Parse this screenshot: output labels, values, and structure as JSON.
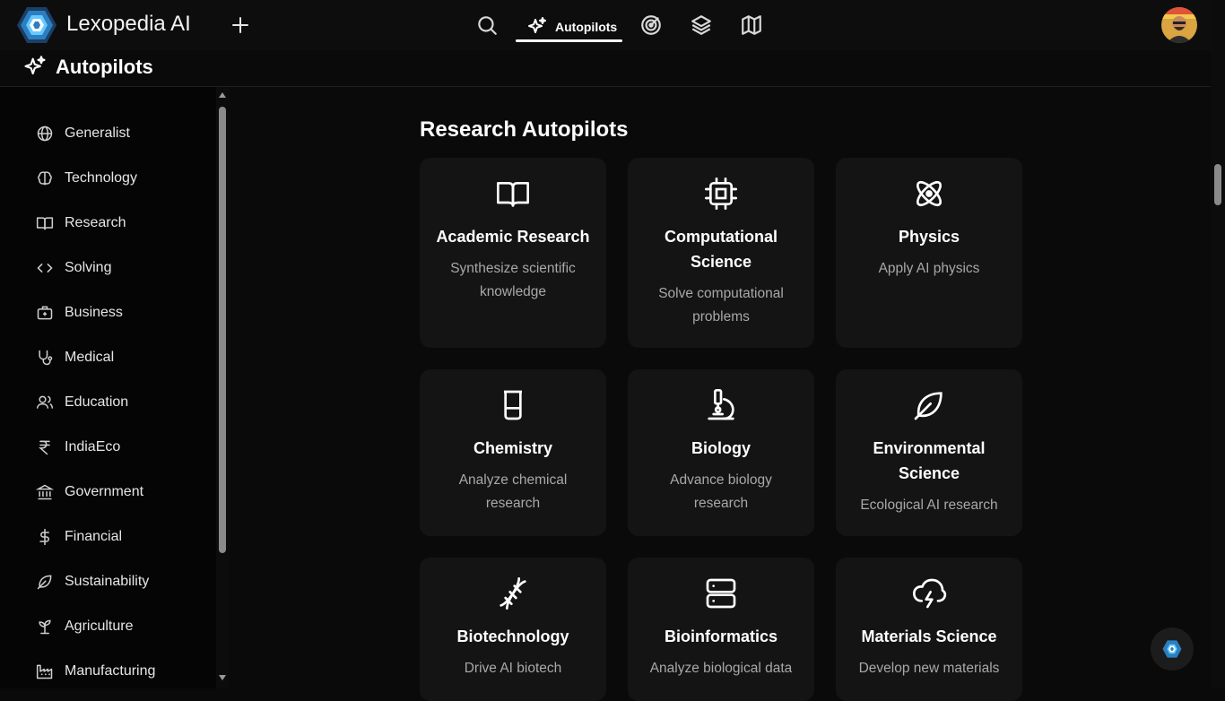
{
  "app": {
    "title": "Lexopedia AI"
  },
  "nav": {
    "active_label": "Autopilots"
  },
  "page": {
    "title": "Autopilots"
  },
  "sidebar": {
    "items": [
      {
        "label": "Generalist",
        "icon": "globe-icon"
      },
      {
        "label": "Technology",
        "icon": "brain-icon"
      },
      {
        "label": "Research",
        "icon": "book-open-icon"
      },
      {
        "label": "Solving",
        "icon": "code-icon"
      },
      {
        "label": "Business",
        "icon": "briefcase-icon"
      },
      {
        "label": "Medical",
        "icon": "stethoscope-icon"
      },
      {
        "label": "Education",
        "icon": "users-icon"
      },
      {
        "label": "IndiaEco",
        "icon": "rupee-icon"
      },
      {
        "label": "Government",
        "icon": "landmark-icon"
      },
      {
        "label": "Financial",
        "icon": "dollar-icon"
      },
      {
        "label": "Sustainability",
        "icon": "leaf-icon"
      },
      {
        "label": "Agriculture",
        "icon": "sprout-icon"
      },
      {
        "label": "Manufacturing",
        "icon": "factory-icon"
      }
    ]
  },
  "main": {
    "section_title": "Research Autopilots",
    "cards": [
      {
        "title": "Academic Research",
        "desc": "Synthesize scientific knowledge",
        "icon": "book-open-icon"
      },
      {
        "title": "Computational Science",
        "desc": "Solve computational problems",
        "icon": "cpu-icon"
      },
      {
        "title": "Physics",
        "desc": "Apply AI physics",
        "icon": "atom-icon"
      },
      {
        "title": "Chemistry",
        "desc": "Analyze chemical research",
        "icon": "beaker-icon"
      },
      {
        "title": "Biology",
        "desc": "Advance biology research",
        "icon": "microscope-icon"
      },
      {
        "title": "Environmental Science",
        "desc": "Ecological AI research",
        "icon": "leaf-icon"
      },
      {
        "title": "Biotechnology",
        "desc": "Drive AI biotech",
        "icon": "dna-icon"
      },
      {
        "title": "Bioinformatics",
        "desc": "Analyze biological data",
        "icon": "server-icon"
      },
      {
        "title": "Materials Science",
        "desc": "Develop new materials",
        "icon": "cloud-lightning-icon"
      }
    ]
  },
  "colors": {
    "background": "#0a0a0a",
    "card": "#141414",
    "text_muted": "#a8a8a8",
    "logo_accent": "#3fa9f5"
  }
}
